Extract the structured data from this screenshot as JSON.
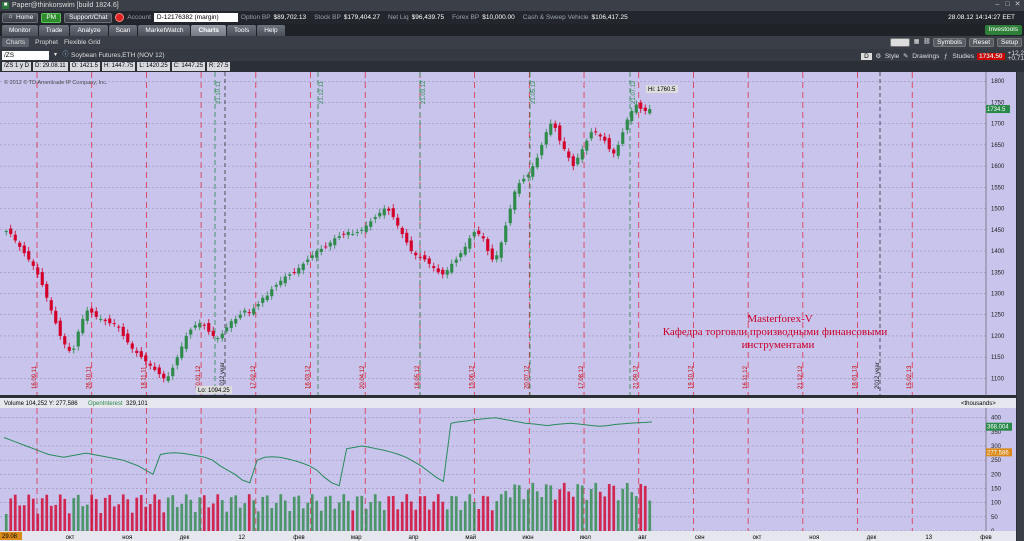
{
  "window": {
    "title": "Paper@thinkorswim [build 1824.6]"
  },
  "account": {
    "home": "Home",
    "pm": "PM",
    "support": "Support/Chat",
    "account_label": "Account",
    "account_value": "D-12176382 (margin)",
    "stats": [
      {
        "label": "Option BP",
        "value": "$89,702.13"
      },
      {
        "label": "Stock BP",
        "value": "$179,404.27"
      },
      {
        "label": "Net Liq",
        "value": "$96,439.75"
      },
      {
        "label": "Forex BP",
        "value": "$10,000.00"
      },
      {
        "label": "Cash & Sweep Vehicle",
        "value": "$106,417.25"
      }
    ],
    "datetime": "28.08.12 14:14:27 EET"
  },
  "tabs": [
    "Monitor",
    "Trade",
    "Analyze",
    "Scan",
    "MarketWatch",
    "Charts",
    "Tools",
    "Help"
  ],
  "active_tab": "Charts",
  "investools": "Investools",
  "subtabs": [
    "Charts",
    "Prophet",
    "Flexible Grid"
  ],
  "toolbar": {
    "symbols": "Symbols",
    "reset": "Reset",
    "setup": "Setup"
  },
  "symbol": {
    "value": "/ZS",
    "description": "Soybean Futures,ETH (NOV 12)",
    "period": "D",
    "style": "Style",
    "drawings": "Drawings",
    "studies": "Studies",
    "last": "1734.50",
    "change_pts": "+12.2",
    "change_pct": "+0.71"
  },
  "ohlc": [
    "/ZS 1 y D",
    "D: 29.08.11",
    "O: 1421.5",
    "H: 1447.75",
    "L: 1420.25",
    "C: 1447.25",
    "R: 27.5"
  ],
  "copyright": "© 2012 © TD Ameritrade IP Company, Inc.",
  "volume_bar": {
    "label": "Volume",
    "value": "104,252",
    "y_label": "Y: 277,586",
    "oi_label": "OpenInterest",
    "oi_value": "329,101",
    "units": "<thousands>"
  },
  "watermark": {
    "line1": "Masterforex-V",
    "line2": "Кафедра торговли производными финансовыми",
    "line3": "инструментами"
  },
  "colors": {
    "chart_bg": "#c8c4ec",
    "up": "#2e8b4a",
    "down": "#d2002a",
    "oi": "#2a8a5a",
    "watermark": "#c8002a"
  },
  "chart_data": {
    "type": "candlestick",
    "y_ticks": [
      1100,
      1150,
      1200,
      1250,
      1300,
      1350,
      1400,
      1450,
      1500,
      1550,
      1600,
      1650,
      1700,
      1750,
      1800
    ],
    "ylim": [
      1075,
      1810
    ],
    "hi_label": "Hi: 1760.5",
    "lo_label": "Lo: 1094.25",
    "last_label": "1734.5",
    "week_labels": [
      "16.09.11",
      "26.10.11",
      "18.11.11",
      "20.01.12",
      "17.02.12",
      "16.03.12",
      "20.04.12",
      "18.05.12",
      "15.06.12",
      "20.07.12",
      "17.08.12",
      "21.09.12",
      "19.10.12",
      "16.11.12",
      "21.12.12",
      "18.01.13",
      "15.02.13"
    ],
    "month_markers": [
      "21.10.11",
      "21.12.11",
      "21.03.12",
      "21.05.12",
      "21.07.12"
    ],
    "year_markers": [
      "2012 year",
      "2012 year"
    ],
    "x_months": [
      "окт",
      "ноя",
      "дек",
      "12",
      "фев",
      "мар",
      "апр",
      "май",
      "июн",
      "июл",
      "авг",
      "сен",
      "окт",
      "ноя",
      "дек",
      "13",
      "фев"
    ],
    "date_box": "29.08",
    "close_path": [
      1447,
      1440,
      1425,
      1410,
      1395,
      1380,
      1365,
      1345,
      1320,
      1290,
      1260,
      1230,
      1200,
      1180,
      1165,
      1170,
      1210,
      1240,
      1260,
      1255,
      1245,
      1240,
      1235,
      1230,
      1228,
      1220,
      1200,
      1185,
      1170,
      1160,
      1150,
      1140,
      1130,
      1120,
      1110,
      1100,
      1105,
      1125,
      1150,
      1175,
      1200,
      1215,
      1225,
      1230,
      1225,
      1210,
      1200,
      1195,
      1205,
      1220,
      1235,
      1240,
      1250,
      1260,
      1255,
      1265,
      1275,
      1290,
      1295,
      1310,
      1320,
      1330,
      1340,
      1345,
      1350,
      1360,
      1370,
      1380,
      1390,
      1400,
      1405,
      1410,
      1420,
      1430,
      1435,
      1440,
      1445,
      1440,
      1445,
      1450,
      1460,
      1470,
      1480,
      1490,
      1500,
      1495,
      1480,
      1460,
      1440,
      1420,
      1400,
      1390,
      1385,
      1380,
      1370,
      1360,
      1350,
      1345,
      1355,
      1370,
      1380,
      1395,
      1410,
      1430,
      1445,
      1440,
      1430,
      1400,
      1380,
      1390,
      1420,
      1460,
      1500,
      1540,
      1560,
      1570,
      1580,
      1600,
      1620,
      1650,
      1680,
      1700,
      1690,
      1660,
      1640,
      1620,
      1600,
      1620,
      1640,
      1660,
      1680,
      1680,
      1670,
      1660,
      1640,
      1630,
      1650,
      1680,
      1710,
      1730,
      1745,
      1735,
      1730,
      1734.5
    ],
    "volume_ylim": [
      0,
      420
    ],
    "volume_ticks": [
      0,
      50,
      100,
      150,
      200,
      250,
      300,
      350,
      400
    ],
    "oi_value": "368.004",
    "y_value": "277.586",
    "oi_path": [
      330,
      320,
      310,
      300,
      290,
      280,
      270,
      265,
      260,
      265,
      270,
      275,
      270,
      265,
      260,
      255,
      250,
      240,
      230,
      215,
      200,
      270,
      275,
      276,
      274,
      270,
      265,
      260,
      250,
      230,
      215,
      200,
      180,
      170,
      250,
      260,
      262,
      260,
      255,
      248,
      240,
      230,
      215,
      190,
      170,
      160,
      290,
      295,
      300,
      296,
      290,
      285,
      278,
      270,
      260,
      245,
      230,
      210,
      190,
      175,
      380,
      385,
      388,
      392,
      395,
      398,
      400,
      395,
      390,
      385,
      380,
      378,
      375,
      372,
      376,
      378,
      380,
      378,
      375,
      372,
      370,
      372,
      376,
      378,
      380,
      382,
      383,
      385
    ]
  }
}
